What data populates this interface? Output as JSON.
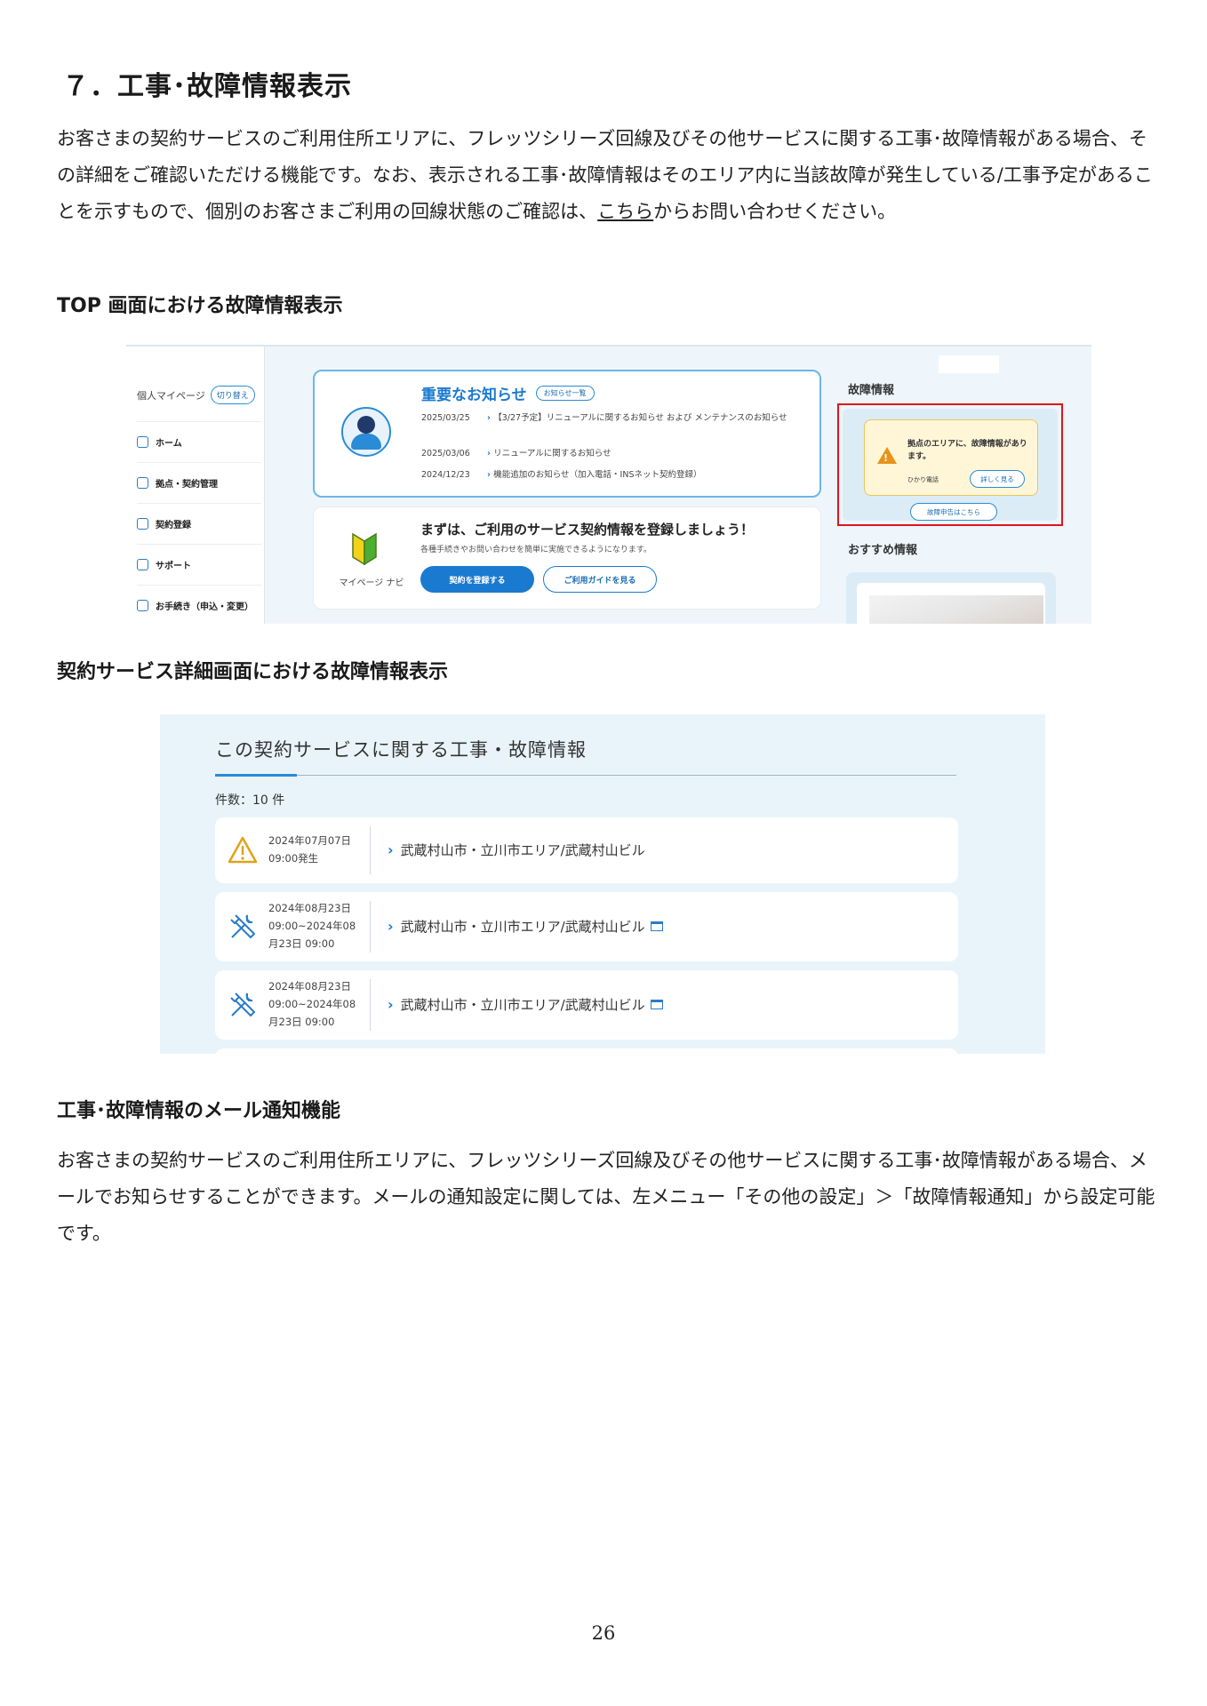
{
  "heading": "７．工事･故障情報表示",
  "intro": {
    "before_link": "お客さまの契約サービスのご利用住所エリアに、フレッツシリーズ回線及びその他サービスに関する工事･故障情報がある場合、その詳細をご確認いただける機能です。なお、表示される工事･故障情報はそのエリア内に当該故障が発生している/工事予定があることを示すもので、個別のお客さまご利用の回線状態のご確認は、",
    "link": "こちら",
    "after_link": "からお問い合わせください。"
  },
  "section1_title": "TOP 画面における故障情報表示",
  "top_screen": {
    "sidebar": {
      "title": "個人マイページ",
      "switch_label": "切り替え",
      "items": [
        "ホーム",
        "拠点・契約管理",
        "契約登録",
        "サポート",
        "お手続き（申込・変更）"
      ]
    },
    "notice": {
      "title": "重要なお知らせ",
      "list_button": "お知らせ一覧",
      "items": [
        {
          "date": "2025/03/25",
          "text": "【3/27予定】リニューアルに関するお知らせ および メンテナンスのお知らせ"
        },
        {
          "date": "2025/03/06",
          "text": "リニューアルに関するお知らせ"
        },
        {
          "date": "2024/12/23",
          "text": "機能追加のお知らせ（加入電話・INSネット契約登録）"
        }
      ]
    },
    "navi": {
      "label": "マイページ ナビ",
      "title": "まずは、ご利用のサービス契約情報を登録しましょう！",
      "subtitle": "各種手続きやお問い合わせを簡単に実施できるようになります。",
      "primary_button": "契約を登録する",
      "secondary_button": "ご利用ガイドを見る"
    },
    "fault": {
      "title": "故障情報",
      "alert_text": "拠点のエリアに、故障情報があります。",
      "service": "ひかり電話",
      "details_button": "詳しく見る",
      "report_button": "故障申告はこちら"
    },
    "recommend_title": "おすすめ情報"
  },
  "section2_title": "契約サービス詳細画面における故障情報表示",
  "detail_screen": {
    "title": "この契約サービスに関する工事・故障情報",
    "count": "件数：10 件",
    "rows": [
      {
        "icon": "warning-icon",
        "date_line1": "2024年07月07日",
        "date_line2": "09:00発生",
        "date_line3": "",
        "location": "武蔵村山市・立川市エリア/武蔵村山ビル"
      },
      {
        "icon": "tools-icon",
        "date_line1": "2024年08月23日",
        "date_line2": "09:00~2024年08",
        "date_line3": "月23日 09:00",
        "location": "武蔵村山市・立川市エリア/武蔵村山ビル"
      },
      {
        "icon": "tools-icon",
        "date_line1": "2024年08月23日",
        "date_line2": "09:00~2024年08",
        "date_line3": "月23日 09:00",
        "location": "武蔵村山市・立川市エリア/武蔵村山ビル"
      }
    ]
  },
  "section3_title": "工事･故障情報のメール通知機能",
  "mail_paragraph": "お客さまの契約サービスのご利用住所エリアに、フレッツシリーズ回線及びその他サービスに関する工事･故障情報がある場合、メールでお知らせすることができます。メールの通知設定に関しては、左メニュー「その他の設定」＞「故障情報通知」から設定可能です。",
  "page_number": "26",
  "colors": {
    "accent": "#1a7ad0",
    "highlight_frame": "#e0141e",
    "warning": "#e8921a"
  }
}
